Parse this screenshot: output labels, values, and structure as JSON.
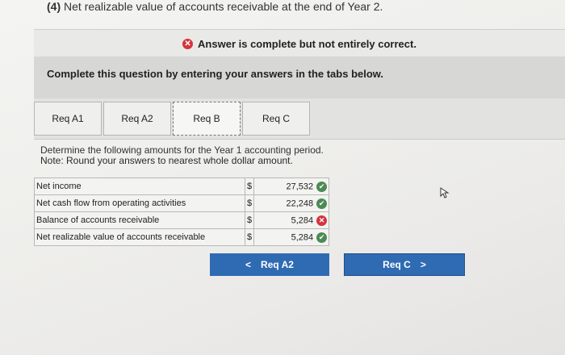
{
  "question": {
    "number": "(4)",
    "text": "Net realizable value of accounts receivable at the end of Year 2."
  },
  "status": {
    "icon": "x-circle-icon",
    "text": "Answer is complete but not entirely correct.",
    "color": "#d4343c"
  },
  "instruction": "Complete this question by entering your answers in the tabs below.",
  "tabs": [
    {
      "label": "Req A1"
    },
    {
      "label": "Req A2"
    },
    {
      "label": "Req B"
    },
    {
      "label": "Req C"
    }
  ],
  "active_tab": "Req B",
  "determine": {
    "line1": "Determine the following amounts for the Year 1 accounting period.",
    "line2": "Note: Round your answers to nearest whole dollar amount."
  },
  "rows": [
    {
      "label": "Net income",
      "currency": "$",
      "value": "27,532",
      "status": "correct"
    },
    {
      "label": "Net cash flow from operating activities",
      "currency": "$",
      "value": "22,248",
      "status": "correct"
    },
    {
      "label": "Balance of accounts receivable",
      "currency": "$",
      "value": "5,284",
      "status": "incorrect"
    },
    {
      "label": "Net realizable value of accounts receivable",
      "currency": "$",
      "value": "5,284",
      "status": "correct"
    }
  ],
  "nav": {
    "prev_label": "Req A2",
    "next_label": "Req C",
    "prev_icon": "<",
    "next_icon": ">",
    "color": "#2f6bb3"
  },
  "colors": {
    "correct": "#4c8a53",
    "incorrect": "#d4343c"
  }
}
